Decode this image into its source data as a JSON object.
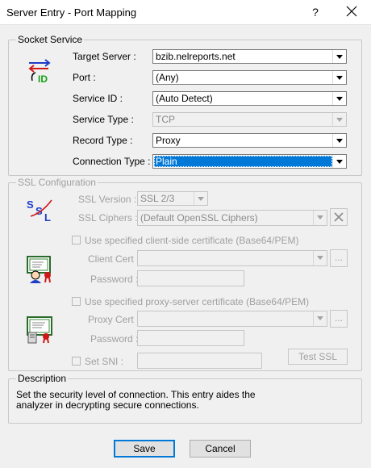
{
  "window": {
    "title": "Server Entry - Port Mapping",
    "help_label": "?"
  },
  "socket_service": {
    "legend": "Socket Service",
    "target_server": {
      "label": "Target Server :",
      "value": "bzib.nelreports.net"
    },
    "port": {
      "label": "Port :",
      "value": "(Any)"
    },
    "service_id": {
      "label": "Service ID :",
      "value": "(Auto Detect)"
    },
    "service_type": {
      "label": "Service Type :",
      "value": "TCP"
    },
    "record_type": {
      "label": "Record Type :",
      "value": "Proxy"
    },
    "connection_type": {
      "label": "Connection Type :",
      "value": "Plain"
    }
  },
  "ssl": {
    "legend": "SSL Configuration",
    "ssl_version": {
      "label": "SSL Version :",
      "value": "SSL 2/3"
    },
    "ssl_ciphers": {
      "label": "SSL Ciphers :",
      "value": "(Default OpenSSL Ciphers)"
    },
    "client_cert_checkbox": "Use specified client-side certificate (Base64/PEM)",
    "client_cert_label": "Client Cert :",
    "client_password_label": "Password :",
    "proxy_cert_checkbox": "Use specified proxy-server certificate (Base64/PEM)",
    "proxy_cert_label": "Proxy Cert :",
    "proxy_password_label": "Password :",
    "set_sni_label": "Set SNI :",
    "browse_label": "...",
    "test_ssl_label": "Test SSL"
  },
  "description": {
    "legend": "Description",
    "text_line1": "Set the security level of connection.  This entry aides the",
    "text_line2": "analyzer in decrypting secure connections."
  },
  "buttons": {
    "save": "Save",
    "cancel": "Cancel"
  },
  "icons": {
    "network_id": "network-id-icon",
    "ssl": "ssl-icon",
    "client_certificate": "client-certificate-icon",
    "server_certificate": "server-certificate-icon"
  },
  "colors": {
    "selection": "#0078d7",
    "disabled_text": "#a0a0a0"
  }
}
